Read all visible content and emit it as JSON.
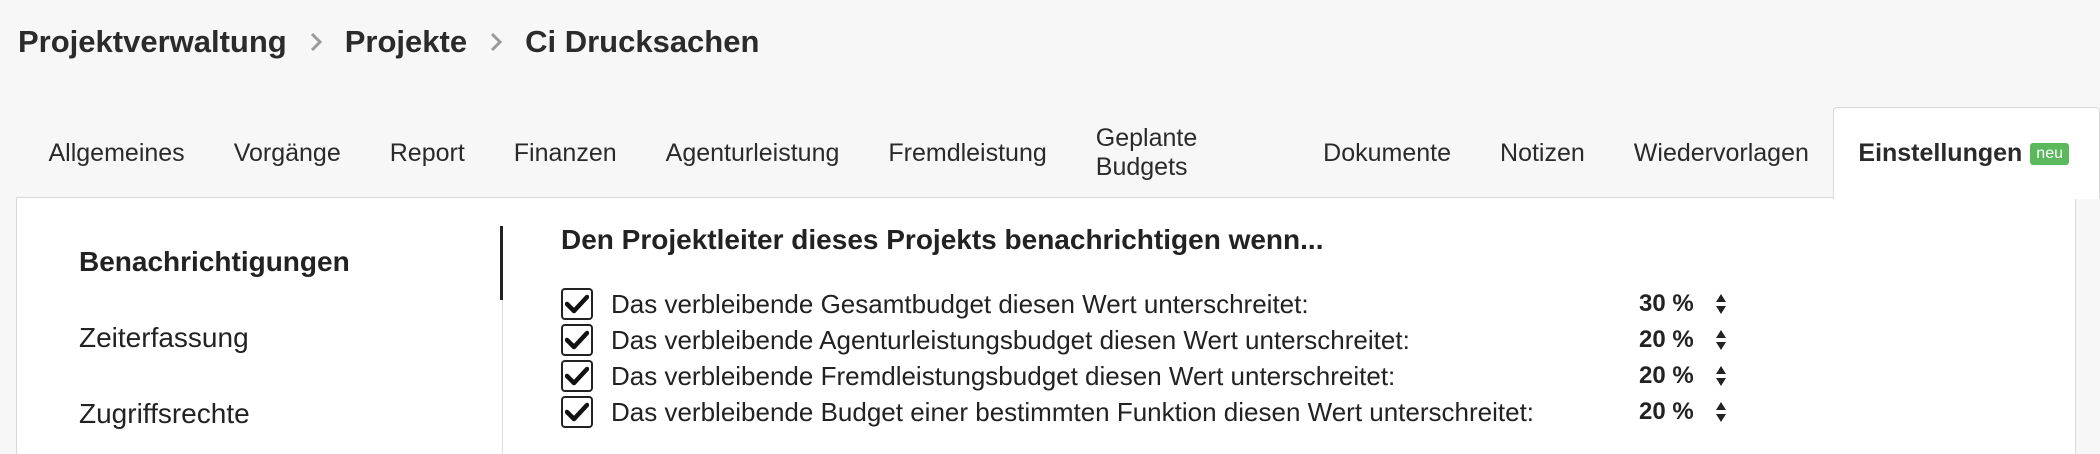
{
  "breadcrumb": {
    "items": [
      "Projektverwaltung",
      "Projekte",
      "Ci Drucksachen"
    ]
  },
  "tabs": [
    {
      "label": "Allgemeines"
    },
    {
      "label": "Vorgänge"
    },
    {
      "label": "Report"
    },
    {
      "label": "Finanzen"
    },
    {
      "label": "Agenturleistung"
    },
    {
      "label": "Fremdleistung"
    },
    {
      "label": "Geplante Budgets"
    },
    {
      "label": "Dokumente"
    },
    {
      "label": "Notizen"
    },
    {
      "label": "Wiedervorlagen"
    },
    {
      "label": "Einstellungen",
      "badge": "neu",
      "active": true
    }
  ],
  "sidenav": {
    "items": [
      {
        "label": "Benachrichtigungen",
        "active": true
      },
      {
        "label": "Zeiterfassung"
      },
      {
        "label": "Zugriffsrechte"
      }
    ]
  },
  "notifications": {
    "heading": "Den Projektleiter dieses Projekts benachrichtigen wenn...",
    "rows": [
      {
        "label": "Das verbleibende Gesamtbudget diesen Wert unterschreitet:",
        "value": "30 %",
        "checked": true
      },
      {
        "label": "Das verbleibende Agenturleistungsbudget diesen Wert unterschreitet:",
        "value": "20 %",
        "checked": true
      },
      {
        "label": "Das verbleibende Fremdleistungsbudget diesen Wert unterschreitet:",
        "value": "20 %",
        "checked": true
      },
      {
        "label": "Das verbleibende Budget einer bestimmten Funktion diesen Wert unterschreitet:",
        "value": "20 %",
        "checked": true
      }
    ]
  },
  "colors": {
    "badge": "#5cb85c",
    "background": "#f7f7f7",
    "panel": "#ffffff"
  }
}
